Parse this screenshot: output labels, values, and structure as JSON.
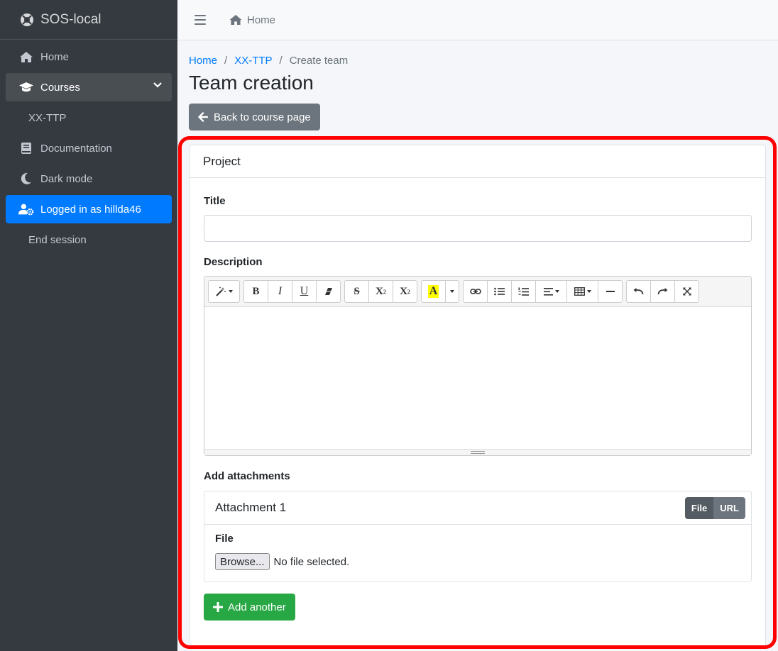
{
  "brand": {
    "name": "SOS-local"
  },
  "sidebar": {
    "items": [
      {
        "label": "Home",
        "icon": "home-icon"
      },
      {
        "label": "Courses",
        "icon": "graduation-cap-icon"
      },
      {
        "label": "XX-TTP"
      },
      {
        "label": "Documentation",
        "icon": "book-icon"
      },
      {
        "label": "Dark mode",
        "icon": "moon-icon"
      },
      {
        "label": "Logged in as hillda46",
        "icon": "user-cog-icon"
      },
      {
        "label": "End session"
      }
    ]
  },
  "header": {
    "home_label": "Home"
  },
  "breadcrumb": {
    "home": "Home",
    "course": "XX-TTP",
    "current": "Create team",
    "separator": "/"
  },
  "page": {
    "title": "Team creation",
    "back_button": "Back to course page"
  },
  "form": {
    "card_title": "Project",
    "title_label": "Title",
    "title_value": "",
    "description_label": "Description",
    "attachments_label": "Add attachments",
    "attachment": {
      "heading": "Attachment 1",
      "mode_file": "File",
      "mode_url": "URL",
      "file_label": "File",
      "browse_label": "Browse...",
      "no_file": "No file selected."
    },
    "add_another": "Add another"
  },
  "toolbar": {
    "bold": "B",
    "italic": "I",
    "underline": "U",
    "strike": "S",
    "superscript": "X",
    "subscript": "X",
    "highlight": "A"
  },
  "colors": {
    "sidebar_bg": "#343a40",
    "active": "#007bff",
    "success": "#28a745",
    "highlight_border": "#ff0000"
  }
}
